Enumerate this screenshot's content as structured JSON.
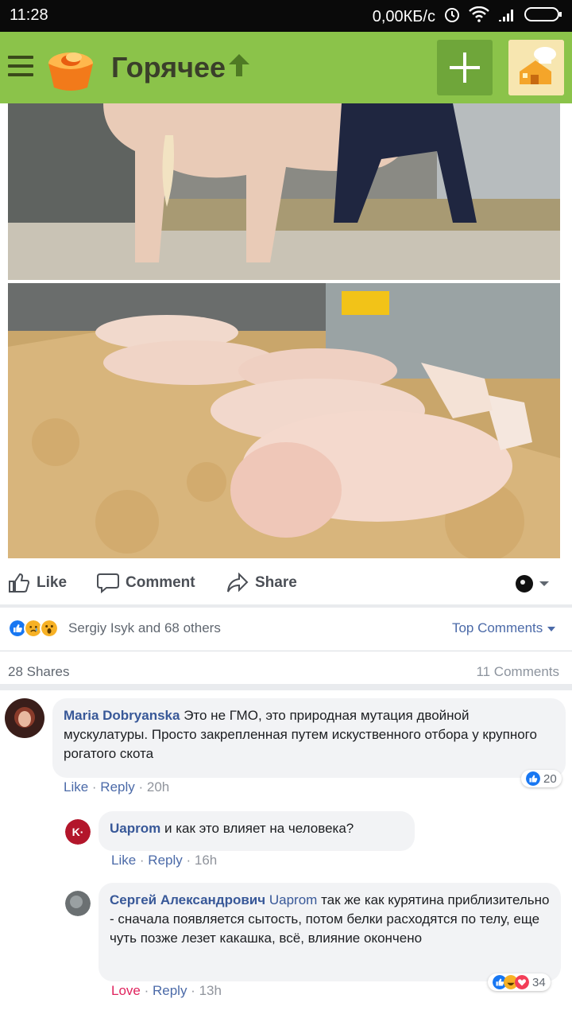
{
  "status_bar": {
    "time": "11:28",
    "net_speed": "0,00КБ/с"
  },
  "app_bar": {
    "title": "Горячее"
  },
  "post": {
    "actions": {
      "like": "Like",
      "comment": "Comment",
      "share": "Share"
    },
    "reactions_text": "Sergiy Isyk and 68 others",
    "top_comments": "Top Comments",
    "shares": "28 Shares",
    "comments_count": "11 Comments"
  },
  "comments": [
    {
      "author": "Maria Dobryanska",
      "text": "Это не ГМО, это природная мутация двойной мускулатуры. Просто закрепленная путем искуственного отбора у крупного рогатого скота",
      "like": "Like",
      "reply": "Reply",
      "time": "20h",
      "reactions": "20"
    },
    {
      "author": "Uaprom",
      "text": "и как это влияет на человека?",
      "like": "Like",
      "reply": "Reply",
      "time": "16h"
    },
    {
      "author": "Сергей Александрович",
      "mention": "Uaprom",
      "text": "так же как курятина приблизительно - сначала появляется сытость, потом белки расходятся по телу, еще чуть позже лезет какашка, всё, влияние окончено",
      "like": "Love",
      "reply": "Reply",
      "time": "13h",
      "reactions": "34"
    }
  ],
  "colors": {
    "app_bar": "#8bc34a",
    "link": "#385898",
    "love": "#e0245e",
    "like_blue": "#1877f2"
  },
  "icons": [
    "menu-icon",
    "app-logo-icon",
    "arrow-up-icon",
    "add-icon",
    "like-icon",
    "comment-icon",
    "share-icon",
    "chevron-down-icon"
  ]
}
